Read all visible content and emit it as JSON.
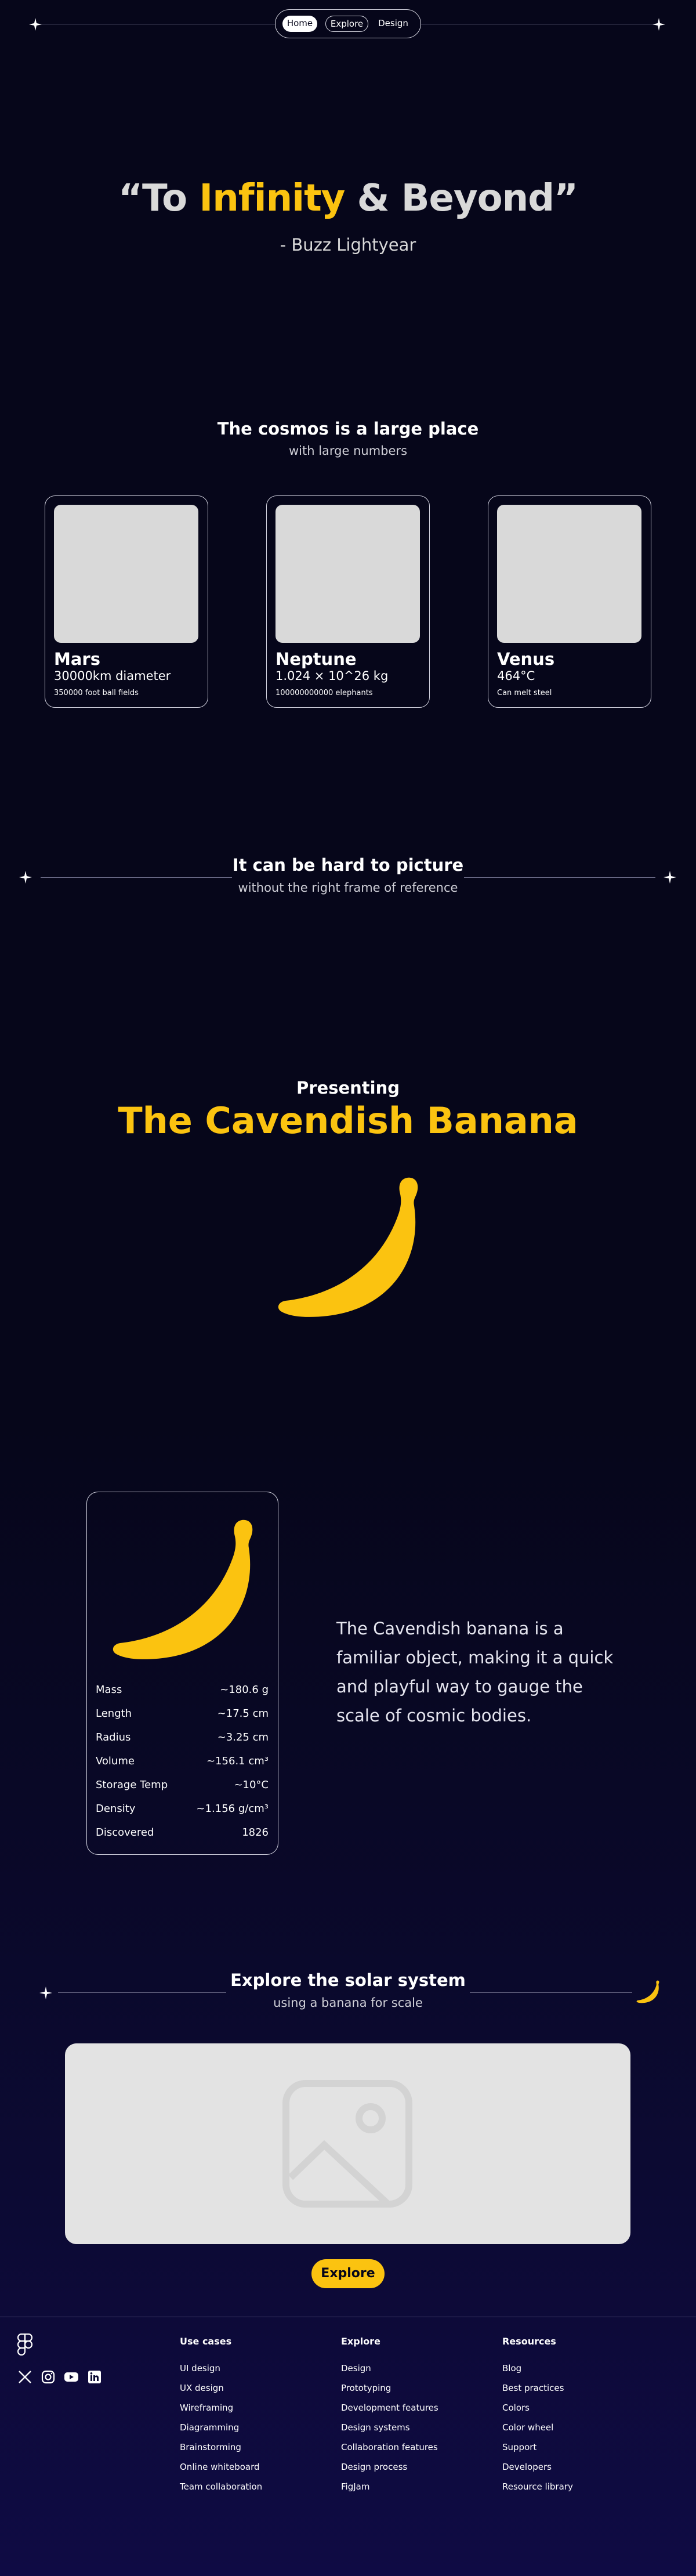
{
  "nav": {
    "items": [
      "Home",
      "Explore",
      "Design"
    ]
  },
  "hero": {
    "quote_open": "“To ",
    "quote_highlight": "Infinity",
    "quote_close": " & Beyond”",
    "attribution": "- Buzz Lightyear"
  },
  "cosmos": {
    "title": "The cosmos is a large place",
    "subtitle": "with large numbers",
    "cards": [
      {
        "name": "Mars",
        "stat": "30000km diameter",
        "sub": "350000 foot ball fields"
      },
      {
        "name": "Neptune",
        "stat": "1.024 × 10^26 kg",
        "sub": "100000000000 elephants"
      },
      {
        "name": "Venus",
        "stat": "464°C",
        "sub": "Can melt steel"
      }
    ]
  },
  "picture": {
    "title": "It can be hard to picture",
    "subtitle": "without the right frame of reference"
  },
  "presenting": {
    "label": "Presenting",
    "title": "The Cavendish Banana"
  },
  "banana_card": {
    "rows": [
      {
        "label": "Mass",
        "value": "~180.6 g"
      },
      {
        "label": "Length",
        "value": "~17.5 cm"
      },
      {
        "label": "Radius",
        "value": "~3.25 cm"
      },
      {
        "label": "Volume",
        "value": "~156.1 cm³"
      },
      {
        "label": "Storage Temp",
        "value": "~10°C"
      },
      {
        "label": "Density",
        "value": "~1.156 g/cm³"
      },
      {
        "label": "Discovered",
        "value": "1826"
      }
    ]
  },
  "description": "The Cavendish banana is a familiar object, making it a quick and playful way to gauge the scale of cosmic bodies.",
  "explore": {
    "title": "Explore the solar system",
    "subtitle": "using a banana for scale",
    "button": "Explore"
  },
  "footer": {
    "columns": [
      {
        "heading": "Use cases",
        "items": [
          "UI design",
          "UX design",
          "Wireframing",
          "Diagramming",
          "Brainstorming",
          "Online whiteboard",
          "Team collaboration"
        ]
      },
      {
        "heading": "Explore",
        "items": [
          "Design",
          "Prototyping",
          "Development features",
          "Design systems",
          "Collaboration features",
          "Design process",
          "FigJam"
        ]
      },
      {
        "heading": "Resources",
        "items": [
          "Blog",
          "Best practices",
          "Colors",
          "Color wheel",
          "Support",
          "Developers",
          "Resource library"
        ]
      }
    ],
    "social_icons": [
      "x-icon",
      "instagram-icon",
      "youtube-icon",
      "linkedin-icon"
    ]
  },
  "colors": {
    "accent": "#fbc310",
    "background": "#06061a"
  }
}
